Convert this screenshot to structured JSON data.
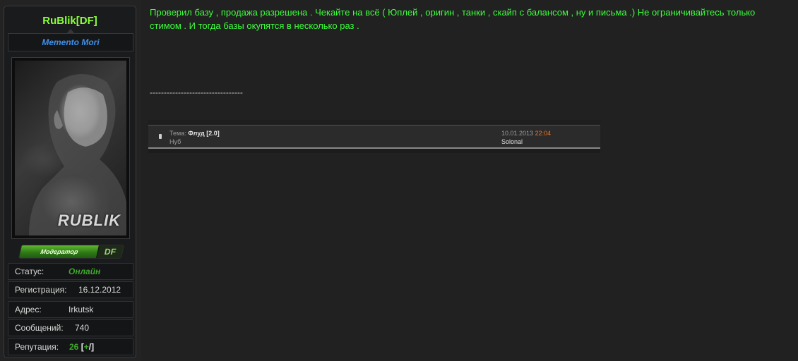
{
  "profile": {
    "username": "RuBlik[DF]",
    "usertitle": "Memento Mori",
    "avatar_text": "RUBLIK",
    "rank_label": "Модератор",
    "rank_group": "DF",
    "stats": {
      "status_label": "Статус:",
      "status_value": "Онлайн",
      "reg_label": "Регистрация:",
      "reg_value": "16.12.2012",
      "addr_label": "Адрес:",
      "addr_value": "Irkutsk",
      "posts_label": "Сообщений:",
      "posts_value": "740",
      "rep_label": "Репутация:",
      "rep_value": "26",
      "rep_open": "[",
      "rep_plus": "+",
      "rep_slash": "/",
      "rep_close": "]"
    }
  },
  "post": {
    "text": "Проверил базу , продажа разрешена . Чекайте на всё ( Юплей , оригин , танки , скайп с балансом , ну и письма .) Не ограничивайтесь только стимом . И тогда базы окупятся в несколько раз .",
    "divider": "---------------------------------",
    "screenshot": {
      "topic_prefix": "Тема:",
      "topic_name": "Флуд [2.0]",
      "author": "Нуб",
      "date": "10.01.2013",
      "time": "22:04",
      "last_poster": "Solonal"
    }
  },
  "colors": {
    "username": "#8cff3c",
    "usertitle": "#3f8fe8",
    "post_text": "#3cff3c",
    "online": "#3ea82c",
    "time": "#e8742a"
  }
}
